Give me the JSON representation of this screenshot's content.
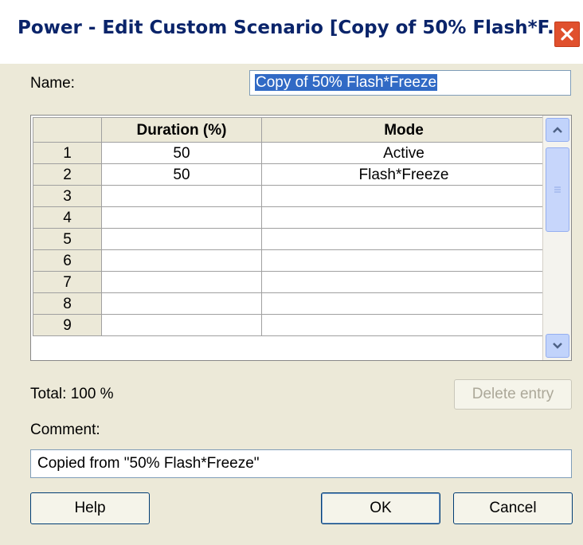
{
  "window": {
    "title": "Power - Edit Custom Scenario [Copy of 50% Flash*F...",
    "close_icon": "close-icon"
  },
  "name": {
    "label": "Name:",
    "value": "Copy of 50% Flash*Freeze"
  },
  "grid": {
    "headers": [
      "",
      "Duration (%)",
      "Mode"
    ],
    "rows": [
      {
        "num": "1",
        "duration": "50",
        "mode": "Active"
      },
      {
        "num": "2",
        "duration": "50",
        "mode": "Flash*Freeze"
      },
      {
        "num": "3",
        "duration": "",
        "mode": ""
      },
      {
        "num": "4",
        "duration": "",
        "mode": ""
      },
      {
        "num": "5",
        "duration": "",
        "mode": ""
      },
      {
        "num": "6",
        "duration": "",
        "mode": ""
      },
      {
        "num": "7",
        "duration": "",
        "mode": ""
      },
      {
        "num": "8",
        "duration": "",
        "mode": ""
      },
      {
        "num": "9",
        "duration": "",
        "mode": ""
      }
    ]
  },
  "total": "Total: 100 %",
  "delete_button": "Delete entry",
  "comment": {
    "label": "Comment:",
    "value": "Copied from \"50% Flash*Freeze\""
  },
  "buttons": {
    "help": "Help",
    "ok": "OK",
    "cancel": "Cancel"
  },
  "colors": {
    "title_text": "#0a246a",
    "close_button": "#e0502d",
    "selection": "#316ac5",
    "dialog_bg": "#ece9d8"
  }
}
